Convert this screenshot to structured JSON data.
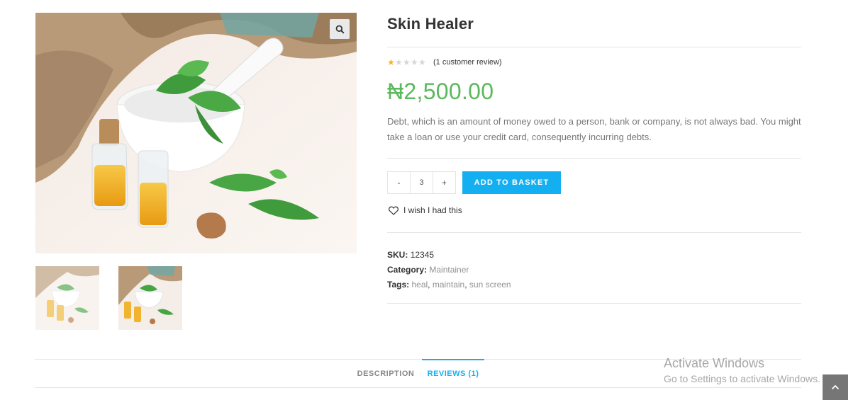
{
  "product": {
    "title": "Skin Healer",
    "rating": 1,
    "rating_max": 5,
    "review_link": "(1 customer review)",
    "price": "₦2,500.00",
    "description": " Debt, which is an amount of money owed to a person, bank or company, is not always bad. You might take a loan or use your credit card, consequently incurring debts.",
    "quantity": "3",
    "qty_minus": "-",
    "qty_plus": "+",
    "add_to_basket": "ADD TO BASKET",
    "wishlist": "I wish I had this",
    "sku_label": "SKU:",
    "sku": "12345",
    "category_label": "Category:",
    "category": "Maintainer",
    "tags_label": "Tags:",
    "tags": [
      "heal",
      "maintain",
      "sun screen"
    ]
  },
  "tabs": [
    {
      "label": "DESCRIPTION",
      "active": false
    },
    {
      "label": "REVIEWS (1)",
      "active": true
    }
  ],
  "watermark": {
    "title": "Activate Windows",
    "subtitle": "Go to Settings to activate Windows."
  },
  "icons": {
    "zoom": "search-icon",
    "wishlist": "heart-icon",
    "scroll_top": "chevron-up-icon"
  },
  "colors": {
    "price": "#5cb85c",
    "accent": "#13aff0",
    "star": "#f5b323"
  }
}
